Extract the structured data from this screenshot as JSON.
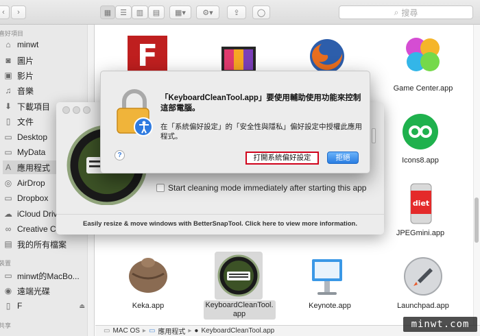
{
  "toolbar": {
    "back_icon": "chevron-left-icon",
    "forward_icon": "chevron-right-icon",
    "search_placeholder": "搜尋"
  },
  "sidebar": {
    "favorites_header": "喜好項目",
    "favorites": [
      {
        "label": "minwt",
        "icon": "home-icon"
      },
      {
        "label": "圖片",
        "icon": "camera-icon"
      },
      {
        "label": "影片",
        "icon": "film-icon"
      },
      {
        "label": "音樂",
        "icon": "music-icon"
      },
      {
        "label": "下載項目",
        "icon": "download-icon"
      },
      {
        "label": "文件",
        "icon": "document-icon"
      },
      {
        "label": "Desktop",
        "icon": "folder-icon"
      },
      {
        "label": "MyData",
        "icon": "folder-icon"
      },
      {
        "label": "應用程式",
        "icon": "applications-icon"
      },
      {
        "label": "AirDrop",
        "icon": "airdrop-icon"
      },
      {
        "label": "Dropbox",
        "icon": "folder-icon"
      },
      {
        "label": "iCloud Drive",
        "icon": "cloud-icon"
      },
      {
        "label": "Creative Cl",
        "icon": "creative-cloud-icon"
      },
      {
        "label": "我的所有檔案",
        "icon": "all-files-icon"
      }
    ],
    "devices_header": "裝置",
    "devices": [
      {
        "label": "minwt的MacBo...",
        "icon": "laptop-icon"
      },
      {
        "label": "遠端光碟",
        "icon": "disc-icon"
      },
      {
        "label": "F",
        "icon": "drive-icon"
      }
    ],
    "shared_header": "共享"
  },
  "apps": [
    {
      "label": "Game Center.app",
      "icon": "game-center-icon"
    },
    {
      "label": "Icons8.app",
      "icon": "icons8-icon"
    },
    {
      "label": "JPEGmini.app",
      "icon": "jpegmini-icon"
    },
    {
      "label": "Keka.app",
      "icon": "keka-icon"
    },
    {
      "label": "KeyboardCleanTool.",
      "label2": "app",
      "icon": "keyboard-clean-icon"
    },
    {
      "label": "Keynote.app",
      "icon": "keynote-icon"
    },
    {
      "label": "Launchpad.app",
      "icon": "launchpad-icon"
    }
  ],
  "pathbar": {
    "items": [
      "MAC OS",
      "應用程式",
      "KeyboardCleanTool.app"
    ],
    "separator": "▸"
  },
  "bettersnap": {
    "checkbox_label": "Start cleaning mode immediately after starting this app",
    "footer": "Easily resize & move windows with BetterSnapTool. Click here to view more information."
  },
  "dialog": {
    "title": "「KeyboardCleanTool.app」要使用輔助使用功能來控制這部電腦。",
    "body": "在「系統偏好設定」的「安全性與隱私」偏好設定中授權此應用程式。",
    "help_label": "?",
    "open_button": "打開系統偏好設定",
    "deny_button": "拒絕",
    "highlight_color": "#d0021b",
    "primary_color": "#2a7de1"
  },
  "watermark": "minwt.com"
}
